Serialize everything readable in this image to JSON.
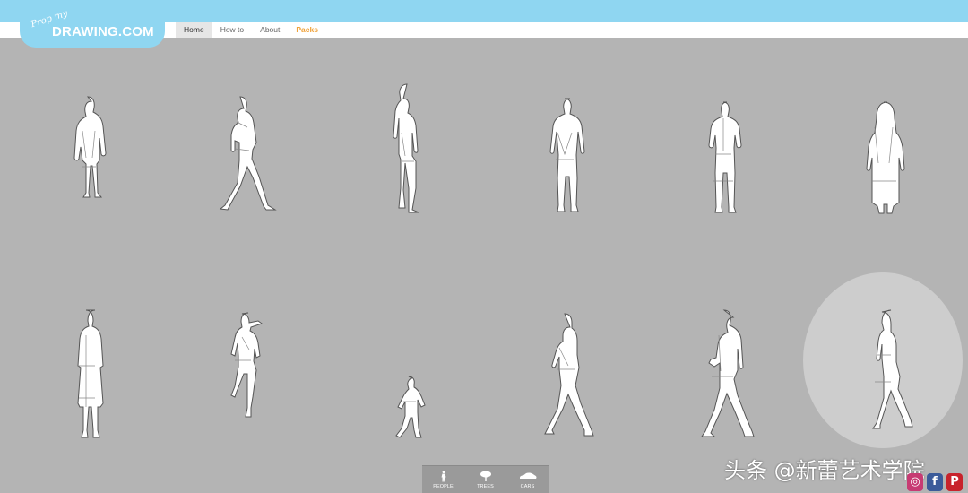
{
  "logo": {
    "script": "Prop my",
    "main": "DRAWING.COM"
  },
  "nav": {
    "home": "Home",
    "howto": "How to",
    "about": "About",
    "packs": "Packs"
  },
  "categories": {
    "people": {
      "label": "PEOPLE",
      "icon": "person-icon"
    },
    "trees": {
      "label": "TREES",
      "icon": "tree-icon"
    },
    "cars": {
      "label": "CARS",
      "icon": "car-icon"
    }
  },
  "figures": [
    {
      "name": "woman-long-coat",
      "icon": "standing-woman"
    },
    {
      "name": "man-walking-phone",
      "icon": "walking-man"
    },
    {
      "name": "man-side-standing",
      "icon": "standing-man-side"
    },
    {
      "name": "man-front-standing",
      "icon": "standing-man-front"
    },
    {
      "name": "man-back-view",
      "icon": "standing-man-back"
    },
    {
      "name": "woman-long-hair-coat",
      "icon": "standing-woman-back"
    },
    {
      "name": "woman-trench-coat",
      "icon": "standing-woman"
    },
    {
      "name": "woman-jogging",
      "icon": "running-woman"
    },
    {
      "name": "child-walking",
      "icon": "walking-child"
    },
    {
      "name": "woman-walking-side",
      "icon": "walking-woman"
    },
    {
      "name": "man-walking-phone-2",
      "icon": "walking-man"
    },
    {
      "name": "woman-walking-highlighted",
      "icon": "walking-woman"
    }
  ],
  "watermark": "头条 @新蕾艺术学院",
  "social": {
    "instagram": "◎",
    "facebook": "f",
    "pinterest": "P"
  },
  "colors": {
    "accent": "#f0a23a",
    "brand": "#8fd6f1",
    "background": "#b4b4b4"
  }
}
